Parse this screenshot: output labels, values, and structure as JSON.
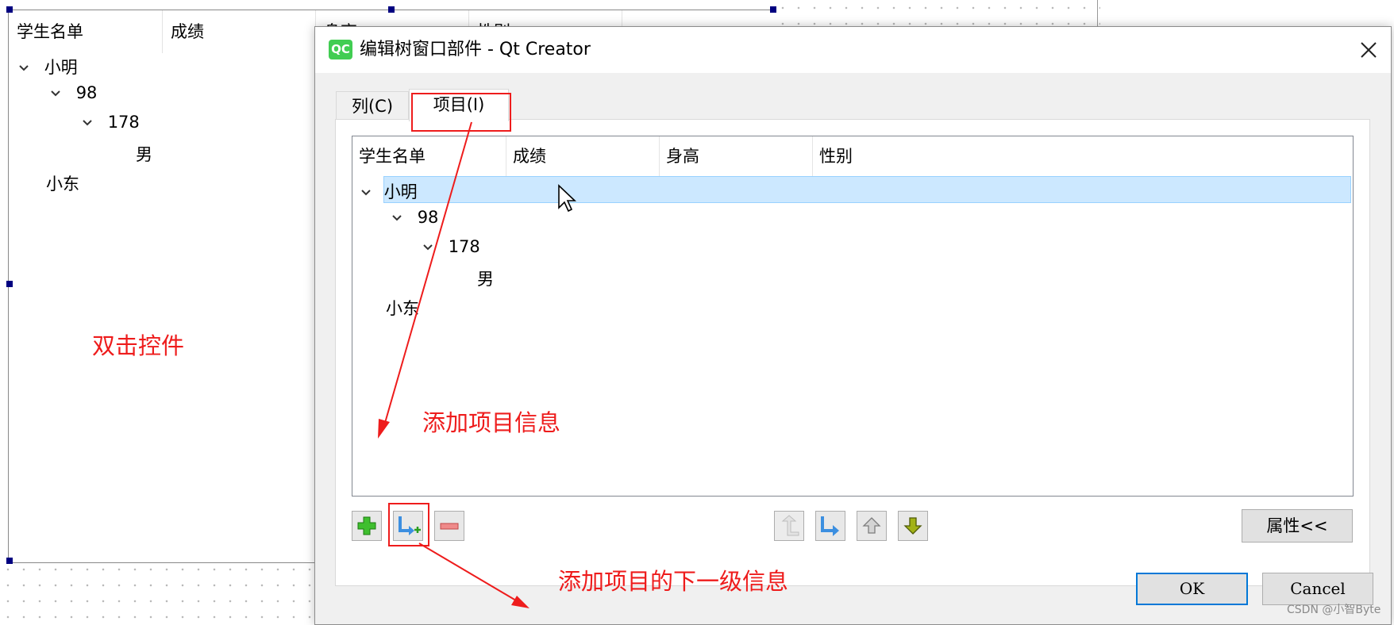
{
  "background": {
    "headers": [
      "学生名单",
      "成绩",
      "身高",
      "性别"
    ],
    "tree": [
      {
        "label": "小明",
        "level": 0,
        "expanded": true
      },
      {
        "label": "98",
        "level": 1,
        "expanded": true
      },
      {
        "label": "178",
        "level": 2,
        "expanded": true
      },
      {
        "label": "男",
        "level": 3
      },
      {
        "label": "小东",
        "level": 0
      }
    ]
  },
  "annotations": {
    "double_click": "双击控件",
    "add_item": "添加项目信息",
    "add_subitem": "添加项目的下一级信息"
  },
  "dialog": {
    "app_icon": "QC",
    "title": "编辑树窗口部件 - Qt Creator",
    "tabs": [
      {
        "label": "列(C)",
        "active": false
      },
      {
        "label": "项目(I)",
        "active": true
      }
    ],
    "tree": {
      "headers": [
        "学生名单",
        "成绩",
        "身高",
        "性别"
      ],
      "rows": [
        {
          "label": "小明",
          "level": 0,
          "expanded": true,
          "selected": true
        },
        {
          "label": "98",
          "level": 1,
          "expanded": true
        },
        {
          "label": "178",
          "level": 2,
          "expanded": true
        },
        {
          "label": "男",
          "level": 3
        },
        {
          "label": "小东",
          "level": 0
        }
      ]
    },
    "properties_button": "属性<<",
    "ok_button": "OK",
    "cancel_button": "Cancel"
  },
  "watermark": "CSDN @小智Byte",
  "colors": {
    "selection": "#cce8ff",
    "annotation": "#ee1c1c",
    "ok_border": "#0078d7"
  },
  "icons": [
    "new-item-icon",
    "new-subitem-icon",
    "delete-item-icon",
    "move-left-icon",
    "move-right-icon",
    "move-up-icon",
    "move-down-icon",
    "close-icon",
    "chevron-down-icon",
    "mouse-cursor-icon"
  ]
}
